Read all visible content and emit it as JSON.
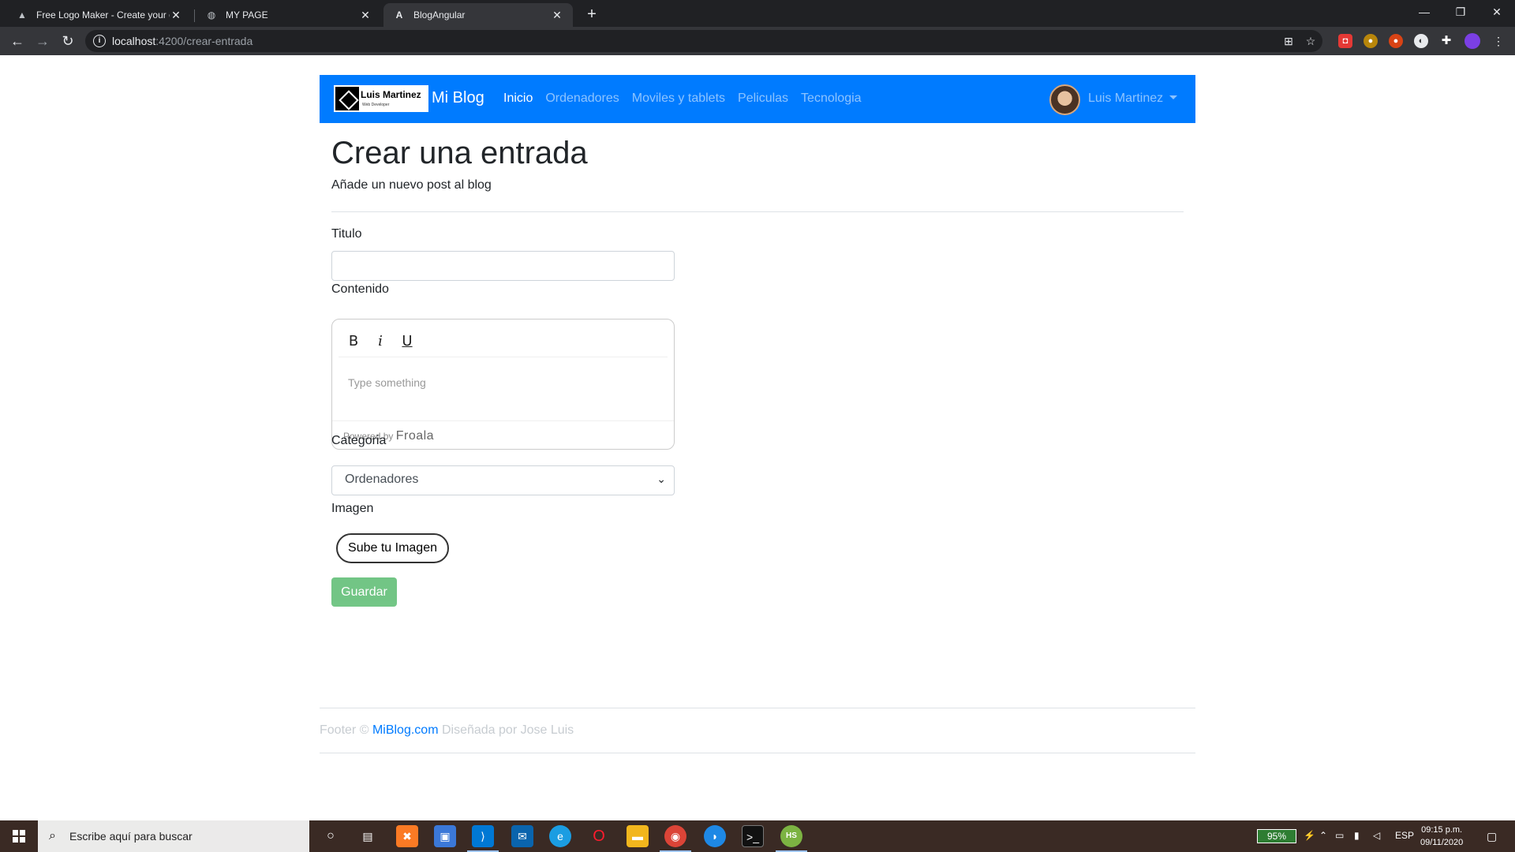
{
  "browser": {
    "tabs": [
      {
        "title": "Free Logo Maker - Create your o",
        "close": "✕"
      },
      {
        "title": "MY PAGE",
        "close": "✕"
      },
      {
        "title": "BlogAngular",
        "close": "✕"
      }
    ],
    "new_tab": "+",
    "url_host": "localhost",
    "url_path": ":4200/crear-entrada"
  },
  "navbar": {
    "logo_name": "Luis Martinez",
    "logo_sub": "Web Developer",
    "brand": "Mi Blog",
    "links": [
      "Inicio",
      "Ordenadores",
      "Moviles y tablets",
      "Peliculas",
      "Tecnologia"
    ],
    "user": "Luis Martinez"
  },
  "main": {
    "title": "Crear una entrada",
    "subtitle": "Añade un nuevo post al blog",
    "title_label": "Titulo",
    "title_value": "",
    "content_label": "Contenido",
    "editor": {
      "bold": "B",
      "italic": "i",
      "underline": "U",
      "placeholder": "Type something",
      "powered_by": "Powered by",
      "powered_brand": "Froala"
    },
    "category_label": "Categoria",
    "category_selected": "Ordenadores",
    "image_label": "Imagen",
    "upload_button": "Sube tu Imagen",
    "save_button": "Guardar"
  },
  "footer": {
    "prefix": "Footer ©",
    "link": "MiBlog.com",
    "suffix": "Diseñada por Jose Luis"
  },
  "taskbar": {
    "search_placeholder": "Escribe aquí para buscar",
    "battery": "95%",
    "language": "ESP",
    "time": "09:15 p.m.",
    "date": "09/11/2020"
  },
  "colors": {
    "navbar": "#007bff",
    "save": "#28a745",
    "link": "#007bff"
  }
}
